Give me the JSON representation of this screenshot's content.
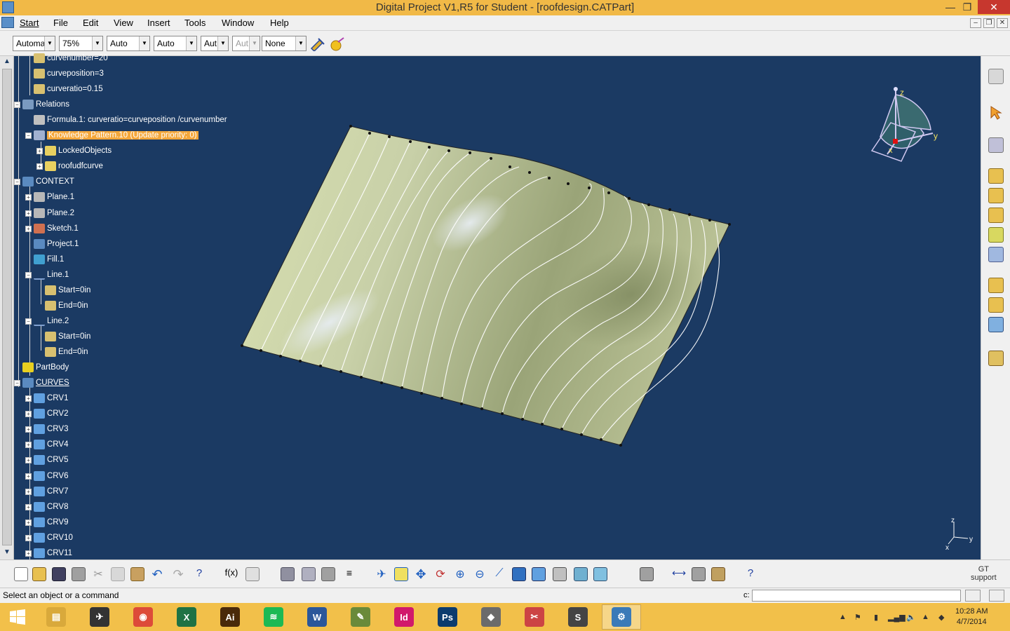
{
  "window": {
    "title": "Digital Project V1,R5 for Student - [roofdesign.CATPart]",
    "minimize": "—",
    "restore": "❐",
    "close": "✕"
  },
  "menu": [
    "Start",
    "File",
    "Edit",
    "View",
    "Insert",
    "Tools",
    "Window",
    "Help"
  ],
  "toolbar": {
    "combos": [
      {
        "value": "Automa",
        "disabled": false
      },
      {
        "value": "75%",
        "disabled": false
      },
      {
        "value": "Auto",
        "disabled": false
      },
      {
        "value": "Auto",
        "disabled": false
      },
      {
        "value": "Aut",
        "disabled": false
      },
      {
        "value": "Aut",
        "disabled": true
      },
      {
        "value": "None",
        "disabled": false
      }
    ]
  },
  "tree": {
    "nodes": [
      {
        "label": "curvenumber=20",
        "icon": "parameter-icon"
      },
      {
        "label": "curveposition=3",
        "icon": "parameter-icon"
      },
      {
        "label": "curveratio=0.15",
        "icon": "parameter-icon"
      },
      {
        "label": "Relations",
        "icon": "relations-icon"
      },
      {
        "label": "Formula.1: curveratio=curveposition /curvenumber",
        "icon": "formula-icon"
      },
      {
        "label": "Knowledge Pattern.10 (Update priority: 0)",
        "icon": "knowledge-pattern-icon"
      },
      {
        "label": "LockedObjects",
        "icon": "list-icon"
      },
      {
        "label": "roofudfcurve",
        "icon": "list-icon"
      },
      {
        "label": "CONTEXT",
        "icon": "geoset-icon"
      },
      {
        "label": "Plane.1",
        "icon": "plane-icon"
      },
      {
        "label": "Plane.2",
        "icon": "plane-icon"
      },
      {
        "label": "Sketch.1",
        "icon": "sketch-icon"
      },
      {
        "label": "Project.1",
        "icon": "project-icon"
      },
      {
        "label": "Fill.1",
        "icon": "fill-icon"
      },
      {
        "label": "Line.1",
        "icon": "line-icon"
      },
      {
        "label": "Start=0in",
        "icon": "parameter-icon"
      },
      {
        "label": "End=0in",
        "icon": "parameter-icon"
      },
      {
        "label": "Line.2",
        "icon": "line-icon"
      },
      {
        "label": "Start=0in",
        "icon": "parameter-icon"
      },
      {
        "label": "End=0in",
        "icon": "parameter-icon"
      },
      {
        "label": "PartBody",
        "icon": "partbody-icon"
      },
      {
        "label": "CURVES",
        "icon": "geoset-icon"
      },
      {
        "label": "CRV1",
        "icon": "curve-icon"
      },
      {
        "label": "CRV2",
        "icon": "curve-icon"
      },
      {
        "label": "CRV3",
        "icon": "curve-icon"
      },
      {
        "label": "CRV4",
        "icon": "curve-icon"
      },
      {
        "label": "CRV5",
        "icon": "curve-icon"
      },
      {
        "label": "CRV6",
        "icon": "curve-icon"
      },
      {
        "label": "CRV7",
        "icon": "curve-icon"
      },
      {
        "label": "CRV8",
        "icon": "curve-icon"
      },
      {
        "label": "CRV9",
        "icon": "curve-icon"
      },
      {
        "label": "CRV10",
        "icon": "curve-icon"
      },
      {
        "label": "CRV11",
        "icon": "curve-icon"
      }
    ]
  },
  "compass": {
    "z": "z",
    "y": "y",
    "x": "x"
  },
  "axis_small": {
    "z": "z",
    "y": "y",
    "x": "x"
  },
  "gt_support": {
    "line1": "GT",
    "line2": "support"
  },
  "status": {
    "message": "Select an object or a command",
    "cmd_label": "c:"
  },
  "taskbar": {
    "apps": [
      {
        "name": "explorer-icon",
        "color": "#d9a93b",
        "glyph": "▤"
      },
      {
        "name": "app-icon",
        "color": "#333333",
        "glyph": "✈"
      },
      {
        "name": "chrome-icon",
        "color": "#dd4b39",
        "glyph": "◉"
      },
      {
        "name": "excel-icon",
        "color": "#1f7244",
        "glyph": "X"
      },
      {
        "name": "illustrator-icon",
        "color": "#4a2a0a",
        "glyph": "Ai"
      },
      {
        "name": "spotify-icon",
        "color": "#1db954",
        "glyph": "≋"
      },
      {
        "name": "word-icon",
        "color": "#2b579a",
        "glyph": "W"
      },
      {
        "name": "project-icon",
        "color": "#6a8a3a",
        "glyph": "✎"
      },
      {
        "name": "indesign-icon",
        "color": "#d1196b",
        "glyph": "Id"
      },
      {
        "name": "photoshop-icon",
        "color": "#0b3b6e",
        "glyph": "Ps"
      },
      {
        "name": "rhino-icon",
        "color": "#6b6b6b",
        "glyph": "◆"
      },
      {
        "name": "snipping-icon",
        "color": "#c44",
        "glyph": "✂"
      },
      {
        "name": "sketchup-icon",
        "color": "#444444",
        "glyph": "S"
      },
      {
        "name": "digital-project-icon",
        "color": "#3a7ab8",
        "glyph": "⚙"
      }
    ],
    "clock_time": "10:28 AM",
    "clock_date": "4/7/2014"
  }
}
